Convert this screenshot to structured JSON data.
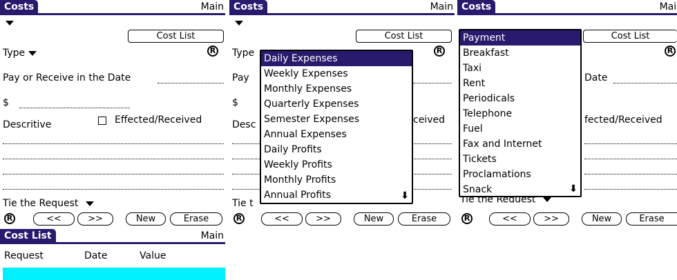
{
  "costs_screen": {
    "title": "Costs",
    "menu": "Main",
    "cost_list_button": "Cost List",
    "type_label": "Type",
    "date_label": "Pay or Receive in the Date",
    "dollar_label": "$",
    "descriptive_label": "Descritive",
    "checkbox_label": "Effected/Received",
    "tie_label": "Tie the Request",
    "prev_button": "<<",
    "next_button": ">>",
    "new_button": "New",
    "erase_button": "Erase",
    "r_label": "R"
  },
  "screen2": {
    "type_partial": "Type",
    "pay_partial": "Pay",
    "desc_partial": "Desc",
    "ceived_partial": "ceived",
    "tie_partial": "Tie t",
    "type_dropdown": {
      "selected": "Daily Expenses",
      "items": [
        "Daily Expenses",
        "Weekly Expenses",
        "Monthly Expenses",
        "Quarterly Expenses",
        "Semester Expenses",
        "Annual Expenses",
        "Daily Profits",
        "Weekly Profits",
        "Monthly Profits",
        "Annual Profits"
      ]
    }
  },
  "screen3": {
    "date_partial": "Date",
    "effected_partial": "fected/Received",
    "tie_partial": "Tie the Request",
    "payment_dropdown": {
      "selected": "Payment",
      "items": [
        "Payment",
        "Breakfast",
        "Taxi",
        "Rent",
        "Periodicals",
        "Telephone",
        "Fuel",
        "Fax and Internet",
        "Tickets",
        "Proclamations",
        "Snack"
      ]
    }
  },
  "cost_list_screen": {
    "title": "Cost List",
    "menu": "Main",
    "columns": [
      "Request",
      "Date",
      "Value"
    ]
  },
  "colors": {
    "title_bar": "#2a1a6e",
    "selection_highlight": "#2a1a6e",
    "list_row_highlight": "#00f0ff"
  },
  "icons": [
    "dropdown-arrow-icon",
    "r-circle-icon",
    "scroll-down-arrow-icon"
  ]
}
